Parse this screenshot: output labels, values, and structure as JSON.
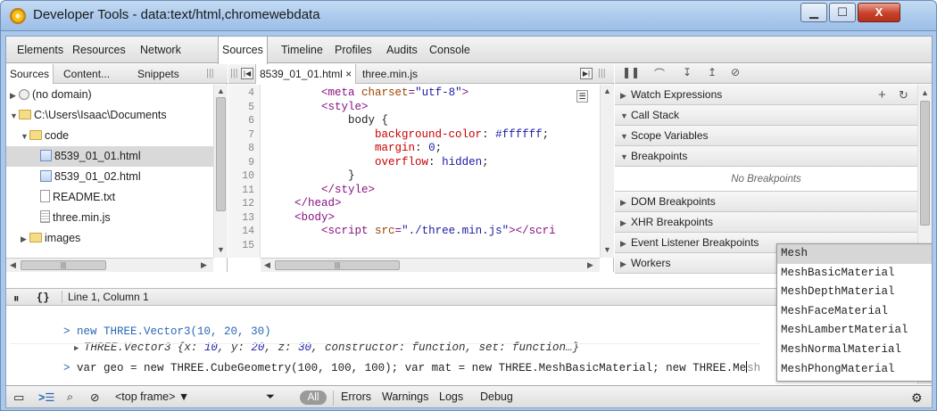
{
  "window": {
    "title": "Developer Tools - data:text/html,chromewebdata",
    "min_glyph": "▁",
    "max_glyph": "☐",
    "close_glyph": "X"
  },
  "main_tabs": [
    "Elements",
    "Resources",
    "Network",
    "Sources",
    "Timeline",
    "Profiles",
    "Audits",
    "Console"
  ],
  "main_tab_active": "Sources",
  "left_pane": {
    "tabs": [
      "Sources",
      "Content...",
      "Snippets"
    ],
    "tree": [
      {
        "label": "(no domain)",
        "icon": "globe-icon",
        "expanded": false
      },
      {
        "label": "C:\\Users\\Isaac\\Documents",
        "icon": "folder-icon",
        "expanded": true
      },
      {
        "label": "code",
        "icon": "folder-icon",
        "expanded": true
      },
      {
        "label": "8539_01_01.html",
        "icon": "html-file-icon",
        "selected": true
      },
      {
        "label": "8539_01_02.html",
        "icon": "html-file-icon"
      },
      {
        "label": "README.txt",
        "icon": "text-file-icon"
      },
      {
        "label": "three.min.js",
        "icon": "js-file-icon"
      },
      {
        "label": "images",
        "icon": "folder-icon",
        "expanded": false
      }
    ]
  },
  "editor": {
    "tabs": [
      {
        "label": "8539_01_01.html ×",
        "active": true
      },
      {
        "label": "three.min.js",
        "active": false
      }
    ],
    "line_numbers": [
      "4",
      "5",
      "6",
      "7",
      "8",
      "9",
      "10",
      "11",
      "12",
      "13",
      "14",
      "15"
    ],
    "code": [
      {
        "indent": "        ",
        "parts": [
          [
            "tag",
            "<meta "
          ],
          [
            "attr",
            "charset"
          ],
          [
            "tag",
            "="
          ],
          [
            "str",
            "\"utf-8\""
          ],
          [
            "tag",
            ">"
          ]
        ]
      },
      {
        "indent": "        ",
        "parts": [
          [
            "tag",
            "<style>"
          ]
        ]
      },
      {
        "indent": "            ",
        "parts": [
          [
            "plain",
            "body {"
          ]
        ]
      },
      {
        "indent": "                ",
        "parts": [
          [
            "prop",
            "background-color"
          ],
          [
            "plain",
            ": "
          ],
          [
            "str",
            "#ffffff"
          ],
          [
            "plain",
            ";"
          ]
        ]
      },
      {
        "indent": "                ",
        "parts": [
          [
            "prop",
            "margin"
          ],
          [
            "plain",
            ": "
          ],
          [
            "str",
            "0"
          ],
          [
            "plain",
            ";"
          ]
        ]
      },
      {
        "indent": "                ",
        "parts": [
          [
            "prop",
            "overflow"
          ],
          [
            "plain",
            ": "
          ],
          [
            "str",
            "hidden"
          ],
          [
            "plain",
            ";"
          ]
        ]
      },
      {
        "indent": "            ",
        "parts": [
          [
            "plain",
            "}"
          ]
        ]
      },
      {
        "indent": "        ",
        "parts": [
          [
            "tag",
            "</style>"
          ]
        ]
      },
      {
        "indent": "    ",
        "parts": [
          [
            "tag",
            "</head>"
          ]
        ]
      },
      {
        "indent": "    ",
        "parts": [
          [
            "tag",
            "<body>"
          ]
        ]
      },
      {
        "indent": "        ",
        "parts": [
          [
            "tag",
            "<script "
          ],
          [
            "attr",
            "src"
          ],
          [
            "tag",
            "="
          ],
          [
            "str",
            "\"./three.min.js\""
          ],
          [
            "tag",
            "></scri"
          ]
        ]
      }
    ]
  },
  "right_pane": {
    "sections": [
      {
        "label": "Watch Expressions",
        "expanded": false
      },
      {
        "label": "Call Stack",
        "expanded": true
      },
      {
        "label": "Scope Variables",
        "expanded": true
      },
      {
        "label": "Breakpoints",
        "expanded": true
      },
      {
        "label": "DOM Breakpoints",
        "expanded": false
      },
      {
        "label": "XHR Breakpoints",
        "expanded": false
      },
      {
        "label": "Event Listener Breakpoints",
        "expanded": false
      },
      {
        "label": "Workers",
        "expanded": false
      }
    ],
    "no_breakpoints": "No Breakpoints"
  },
  "autocomplete": {
    "items": [
      "Mesh",
      "MeshBasicMaterial",
      "MeshDepthMaterial",
      "MeshFaceMaterial",
      "MeshLambertMaterial",
      "MeshNormalMaterial",
      "MeshPhongMaterial"
    ],
    "selected": "Mesh"
  },
  "status": {
    "position": "Line 1, Column 1",
    "braces": "{}"
  },
  "console": {
    "line1": "new THREE.Vector3(10, 20, 30)",
    "result_prefix": "THREE.Vector3 {",
    "result_x_key": "x: ",
    "result_x": "10",
    "result_y_key": ", y: ",
    "result_y": "20",
    "result_z_key": ", z: ",
    "result_z": "30",
    "result_tail": ", constructor: function, set: function…}",
    "input_before_cursor": "var geo = new THREE.CubeGeometry(100, 100, 100); var mat = new THREE.MeshBasicMaterial; new THREE.Me",
    "input_after_cursor": "sh"
  },
  "bottom_bar": {
    "frame": "<top frame>",
    "filter_all": "All",
    "filters": [
      "Errors",
      "Warnings",
      "Logs",
      "Debug"
    ]
  }
}
